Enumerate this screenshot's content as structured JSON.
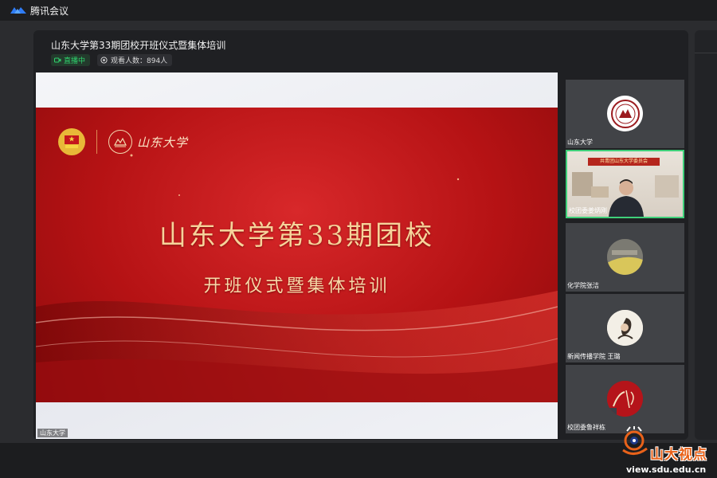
{
  "app": {
    "name": "腾讯会议"
  },
  "meeting": {
    "title": "山东大学第33期团校开班仪式暨集体培训",
    "live_badge": "直播中",
    "viewers_label": "观看人数：894人"
  },
  "share": {
    "presenter": "山东大学",
    "slide_title": "山东大学第33期团校",
    "slide_subtitle": "开班仪式暨集体培训",
    "logo_script": "山东大学"
  },
  "participants": [
    {
      "name": "山东大学",
      "kind": "avatar",
      "icon": "sdu-seal-icon"
    },
    {
      "name": "校团委姜炳刚",
      "kind": "video",
      "banner": "共青团山东大学委员会"
    },
    {
      "name": "化学院张洁",
      "kind": "avatar",
      "icon": "building-photo-icon"
    },
    {
      "name": "新闻传播学院 王璐",
      "kind": "avatar",
      "icon": "ink-portrait-icon"
    },
    {
      "name": "校团委鲁祥栋",
      "kind": "avatar",
      "icon": "calligraphy-icon"
    }
  ],
  "watermark": {
    "brand": "山大视点",
    "url": "view.sdu.edu.cn"
  },
  "colors": {
    "live_green": "#2fd36e",
    "slide_red": "#b51214",
    "slide_gold": "#f6d39a",
    "brand_orange": "#e8621a"
  }
}
